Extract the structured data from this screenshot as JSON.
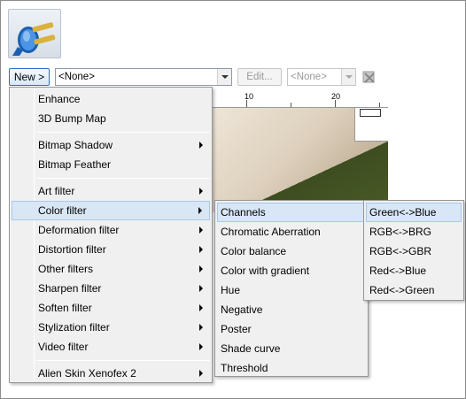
{
  "toolbar": {
    "new_label": "New >",
    "preset_value": "<None>",
    "edit_label": "Edit...",
    "second_value": "<None>"
  },
  "ruler": {
    "tick_10": "10",
    "tick_20": "20"
  },
  "main_menu": {
    "items": [
      {
        "label": "Enhance"
      },
      {
        "label": "3D Bump Map"
      },
      {
        "label": "Bitmap Shadow"
      },
      {
        "label": "Bitmap Feather"
      },
      {
        "label": "Art filter"
      },
      {
        "label": "Color filter"
      },
      {
        "label": "Deformation filter"
      },
      {
        "label": "Distortion filter"
      },
      {
        "label": "Other filters"
      },
      {
        "label": "Sharpen filter"
      },
      {
        "label": "Soften filter"
      },
      {
        "label": "Stylization filter"
      },
      {
        "label": "Video filter"
      },
      {
        "label": "Alien Skin Xenofex 2"
      }
    ]
  },
  "color_filter_menu": {
    "items": [
      {
        "label": "Channels"
      },
      {
        "label": "Chromatic Aberration"
      },
      {
        "label": "Color balance"
      },
      {
        "label": "Color with gradient"
      },
      {
        "label": "Hue"
      },
      {
        "label": "Negative"
      },
      {
        "label": "Poster"
      },
      {
        "label": "Shade curve"
      },
      {
        "label": "Threshold"
      }
    ]
  },
  "channels_menu": {
    "items": [
      {
        "label": "Green<->Blue"
      },
      {
        "label": "RGB<->BRG"
      },
      {
        "label": "RGB<->GBR"
      },
      {
        "label": "Red<->Blue"
      },
      {
        "label": "Red<->Green"
      }
    ]
  },
  "colors": {
    "highlight": "#d8e6f6",
    "highlight_border": "#a9c8ec",
    "menu_bg": "#f0f0f0",
    "accent": "#2a6fc9"
  }
}
